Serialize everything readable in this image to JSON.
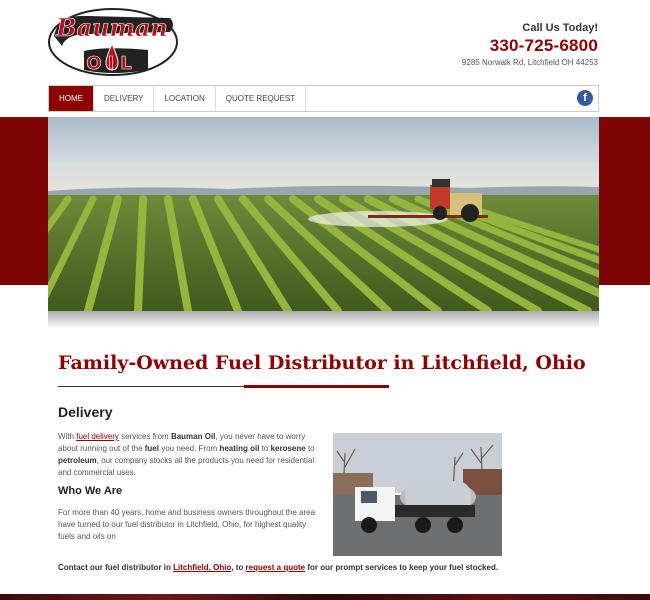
{
  "logo": {
    "line1": "Bauman",
    "line2": "OIL"
  },
  "contact": {
    "cta": "Call Us Today!",
    "phone": "330-725-6800",
    "address": "9285 Norwalk Rd, Litchfield OH 44253"
  },
  "nav": {
    "items": [
      {
        "label": "HOME",
        "active": true
      },
      {
        "label": "DELIVERY",
        "active": false
      },
      {
        "label": "LOCATION",
        "active": false
      },
      {
        "label": "QUOTE REQUEST",
        "active": false
      }
    ],
    "social_icon": "facebook-icon",
    "social_glyph": "f"
  },
  "colors": {
    "brand": "#8b0000",
    "band": "#7d0505",
    "facebook": "#3b5998"
  },
  "main": {
    "headline": "Family-Owned Fuel Distributor in Litchfield, Ohio",
    "delivery_heading": "Delivery",
    "p1": {
      "t1": "With ",
      "link1": "fuel delivery",
      "t2": " services from ",
      "b1": "Bauman Oil",
      "t3": ", you never have to worry about running out of the ",
      "b2": "fuel",
      "t4": " you need. From ",
      "b3": "heating oil",
      "t5": " to ",
      "b4": "kerosene",
      "t6": " to ",
      "b5": "petroleum",
      "t7": ", our company stocks all the products you need for residential and commercial uses."
    },
    "who_heading": "Who We Are",
    "p2": "For more than 40 years, home and business owners throughout the area have turned to our fuel distributor in Litchfield, Ohio, for highest quality fuels and oils on",
    "p3": {
      "t1": "Contact our fuel distributor in ",
      "link1": "Litchfield, Ohio",
      "t2": ", to ",
      "link2": "request a quote",
      "t3": " for our prompt services to keep your fuel stocked."
    }
  }
}
